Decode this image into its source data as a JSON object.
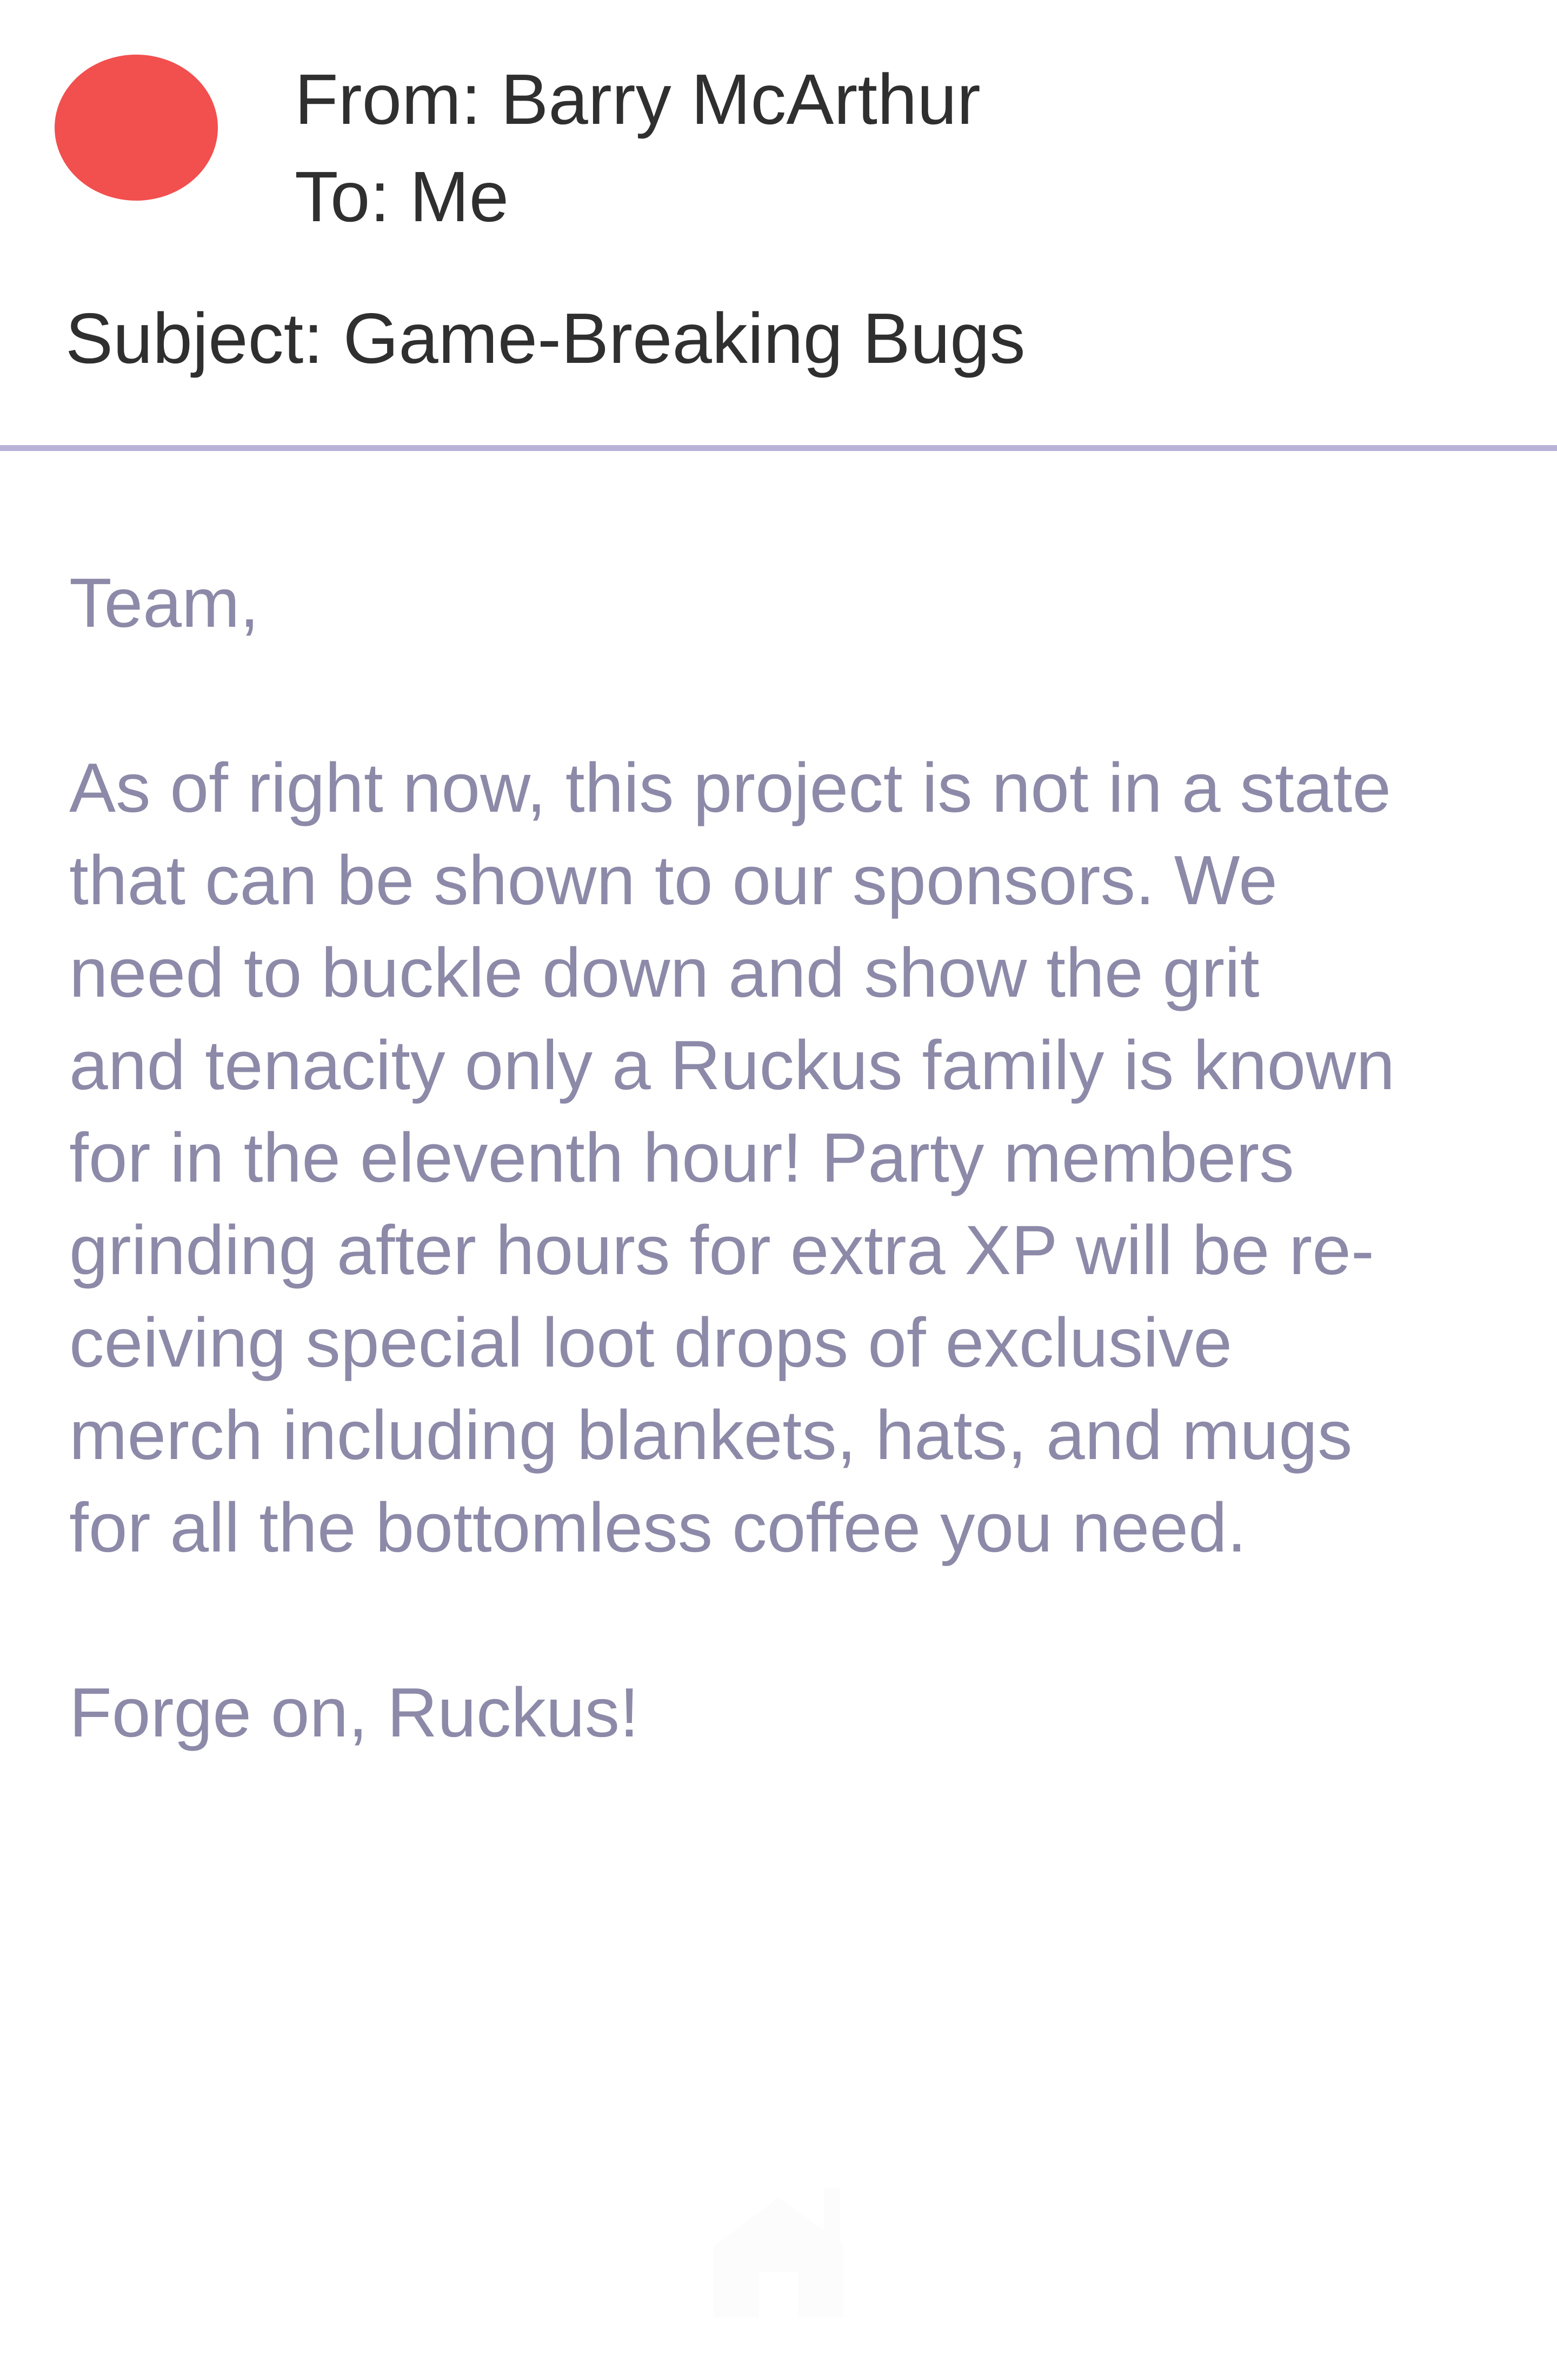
{
  "colors": {
    "avatar": "#f24f4f",
    "divider": "#b8b2d8",
    "header_text": "#2f2f2f",
    "body_text": "#8c8aa8",
    "watermark": "#c9c9cf"
  },
  "email": {
    "from": "From: Barry McArthur",
    "to": "To: Me",
    "subject": "Subject: Game-Breaking Bugs",
    "greeting": "Team,",
    "body_lines": [
      "As of right now, this project is not in a state",
      "that can be shown to our sponsors. We",
      "need to buckle down and show the grit",
      "and tenacity only a Ruckus family is known",
      "for in the eleventh hour! Party members",
      "grinding after hours for extra XP will be re-",
      "ceiving special loot drops of exclusive",
      "merch including blankets, hats, and mugs",
      "for all the bottomless coffee you need."
    ],
    "signoff": "Forge on, Ruckus!"
  },
  "icons": {
    "avatar": "avatar-circle",
    "watermark": "house-logo"
  }
}
